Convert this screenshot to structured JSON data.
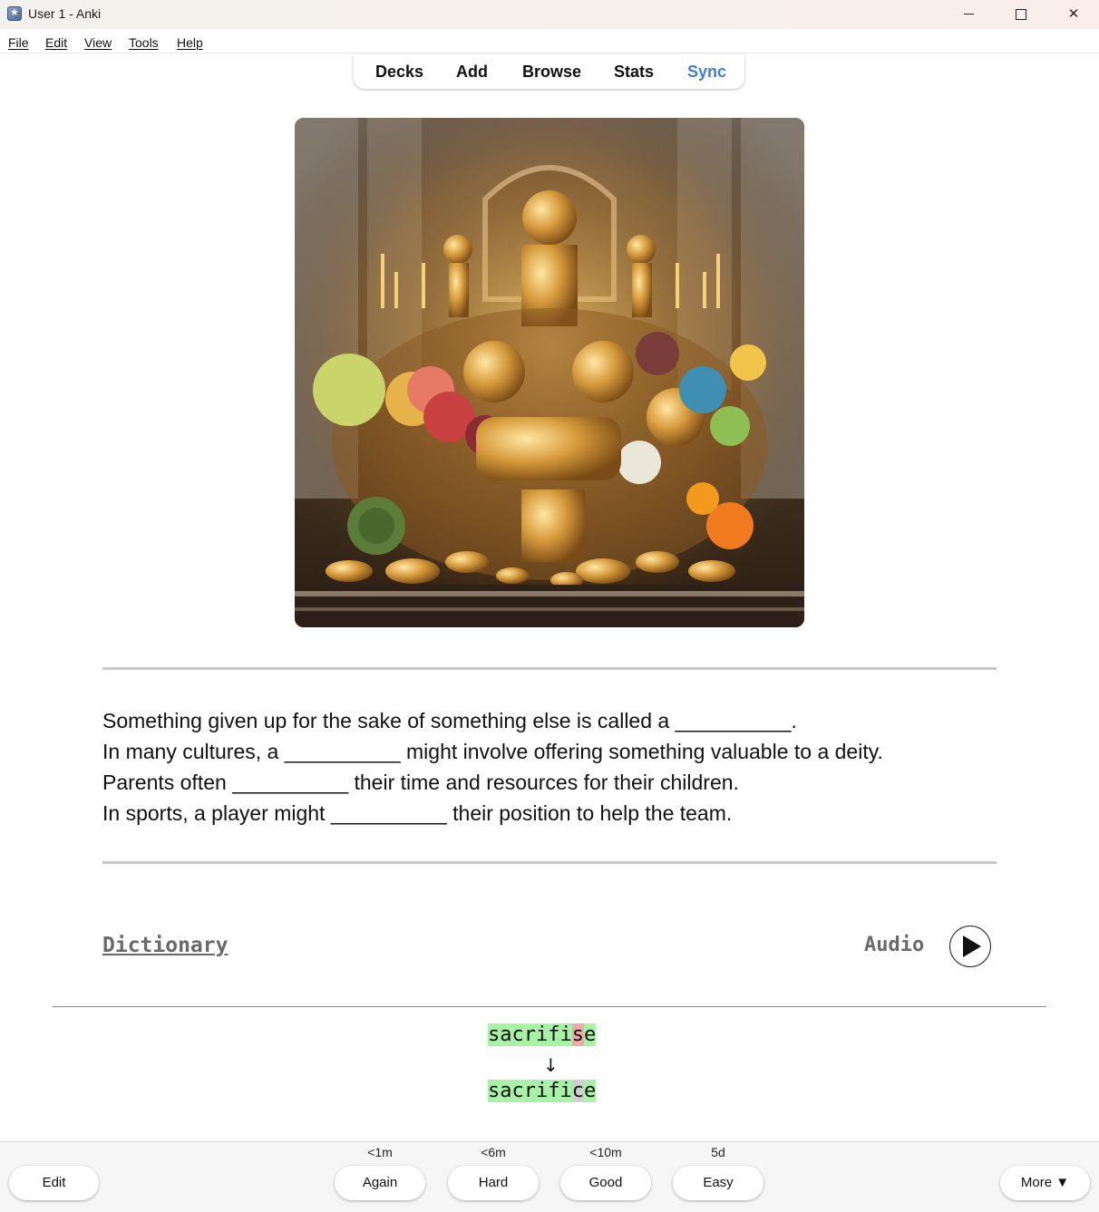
{
  "window": {
    "title": "User 1 - Anki"
  },
  "menu": [
    "File",
    "Edit",
    "View",
    "Tools",
    "Help"
  ],
  "toolbar": {
    "decks": "Decks",
    "add": "Add",
    "browse": "Browse",
    "stats": "Stats",
    "sync": "Sync",
    "sync_color": "#3c7fe0"
  },
  "card": {
    "sentences": [
      "Something given up for the sake of something else is called a __________.",
      "In many cultures, a __________ might involve offering something valuable to a deity.",
      "Parents often __________ their time and resources for their children.",
      "In sports, a player might __________ their position to help the team."
    ],
    "dictionary_link": "Dictionary",
    "audio_label": "Audio",
    "typed_answer": [
      {
        "text": "sacrifi",
        "status": "good"
      },
      {
        "text": "s",
        "status": "bad"
      },
      {
        "text": "e",
        "status": "good"
      }
    ],
    "arrow": "↓",
    "correct_answer": [
      {
        "text": "sacrifi",
        "status": "good"
      },
      {
        "text": "c",
        "status": "missed"
      },
      {
        "text": "e",
        "status": "good"
      }
    ]
  },
  "bottom": {
    "edit": "Edit",
    "more": "More ▼",
    "answers": [
      {
        "label": "Again",
        "interval": "<1m"
      },
      {
        "label": "Hard",
        "interval": "<6m"
      },
      {
        "label": "Good",
        "interval": "<10m"
      },
      {
        "label": "Easy",
        "interval": "5d"
      }
    ]
  },
  "colors": {
    "correct": "#a8f2a8",
    "incorrect": "#f2a8a8",
    "missed": "#cfcfcf"
  }
}
